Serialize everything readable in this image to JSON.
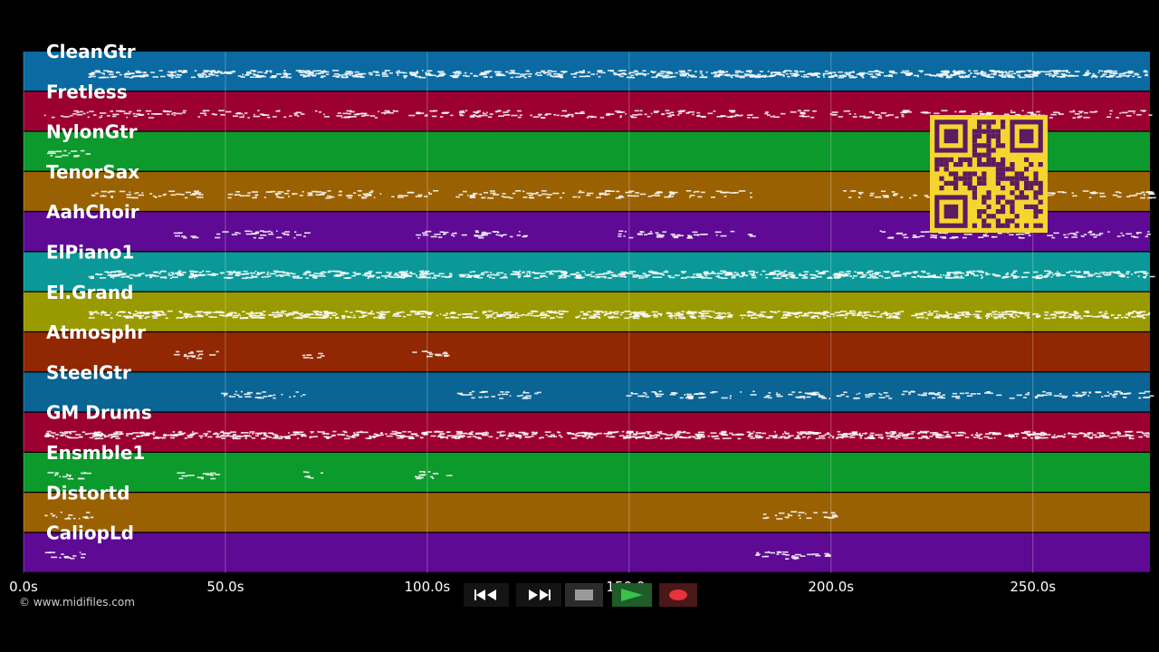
{
  "app": {
    "copyright": "© www.midifiles.com"
  },
  "lanes": [
    {
      "name": "CleanGtr",
      "color": "#0a6aa1"
    },
    {
      "name": "Fretless",
      "color": "#9c0033"
    },
    {
      "name": "NylonGtr",
      "color": "#0c9a2c"
    },
    {
      "name": "TenorSax",
      "color": "#9a6103"
    },
    {
      "name": "AahChoir",
      "color": "#5e0a94"
    },
    {
      "name": "ElPiano1",
      "color": "#0a9898"
    },
    {
      "name": "El.Grand",
      "color": "#999a00"
    },
    {
      "name": "Atmosphr",
      "color": "#912703"
    },
    {
      "name": "SteelGtr",
      "color": "#0a6494"
    },
    {
      "name": "GM Drums",
      "color": "#9c0033"
    },
    {
      "name": "Ensmble1",
      "color": "#0c9a2c"
    },
    {
      "name": "Distortd",
      "color": "#9a6103"
    },
    {
      "name": "CaliopLd",
      "color": "#5e0a94"
    }
  ],
  "timeline": {
    "ticks": [
      "0.0s",
      "50.0s",
      "100.0s",
      "150.0s",
      "200.0s",
      "250.0s"
    ],
    "tick_values": [
      0,
      50,
      100,
      150,
      200,
      250
    ],
    "max_seconds": 279
  },
  "transport": {
    "buttons": [
      {
        "name": "rewind-button",
        "icon": "rewind-icon",
        "color": "#ffffff"
      },
      {
        "name": "fast-forward-button",
        "icon": "fast-forward-icon",
        "color": "#ffffff"
      },
      {
        "name": "stop-button",
        "icon": "stop-icon",
        "color": "#9a9a9a"
      },
      {
        "name": "play-button",
        "icon": "play-icon",
        "color": "#39c24a"
      },
      {
        "name": "record-button",
        "icon": "record-icon",
        "color": "#e8323c"
      }
    ]
  },
  "qr": {
    "fg": "#5b1d5e",
    "bg": "#f7d531"
  }
}
